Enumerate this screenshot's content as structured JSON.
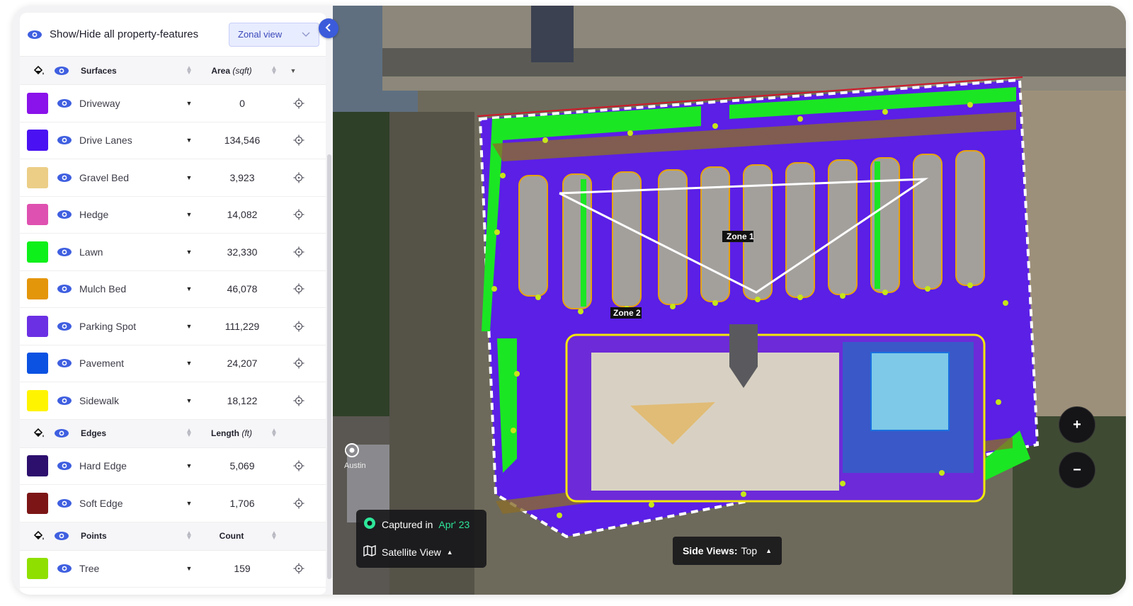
{
  "header": {
    "toggle_all_label": "Show/Hide all property-features",
    "view_select": "Zonal view"
  },
  "sections": {
    "surfaces": {
      "title": "Surfaces",
      "metric_label": "Area",
      "metric_unit": "(sqft)",
      "items": [
        {
          "label": "Driveway",
          "value": "0",
          "color": "#8a12ea"
        },
        {
          "label": "Drive Lanes",
          "value": "134,546",
          "color": "#4a12f2"
        },
        {
          "label": "Gravel Bed",
          "value": "3,923",
          "color": "#ecce87"
        },
        {
          "label": "Hedge",
          "value": "14,082",
          "color": "#df51b0"
        },
        {
          "label": "Lawn",
          "value": "32,330",
          "color": "#0ef01a"
        },
        {
          "label": "Mulch Bed",
          "value": "46,078",
          "color": "#e4960a"
        },
        {
          "label": "Parking Spot",
          "value": "111,229",
          "color": "#6b30e4"
        },
        {
          "label": "Pavement",
          "value": "24,207",
          "color": "#0c52e2"
        },
        {
          "label": "Sidewalk",
          "value": "18,122",
          "color": "#fff400"
        }
      ]
    },
    "edges": {
      "title": "Edges",
      "metric_label": "Length",
      "metric_unit": "(ft)",
      "items": [
        {
          "label": "Hard Edge",
          "value": "5,069",
          "color": "#2d0f6e"
        },
        {
          "label": "Soft Edge",
          "value": "1,706",
          "color": "#7c1616"
        }
      ]
    },
    "points": {
      "title": "Points",
      "metric_label": "Count",
      "items": [
        {
          "label": "Tree",
          "value": "159",
          "color": "#8fe000"
        }
      ]
    }
  },
  "map": {
    "zones": [
      "Zone 1",
      "Zone 2"
    ],
    "place_label": "Austin",
    "capture_prefix": "Captured in",
    "capture_date": "Apr' 23",
    "layer_label": "Satellite View",
    "side_views_label": "Side Views:",
    "side_views_value": "Top",
    "zoom_in": "+",
    "zoom_out": "−"
  },
  "colors": {
    "accent": "#3b5bdb",
    "eye_icon": "#3f5fe0",
    "boundary": "#d01a2a",
    "capture_date": "#2ee79a"
  }
}
